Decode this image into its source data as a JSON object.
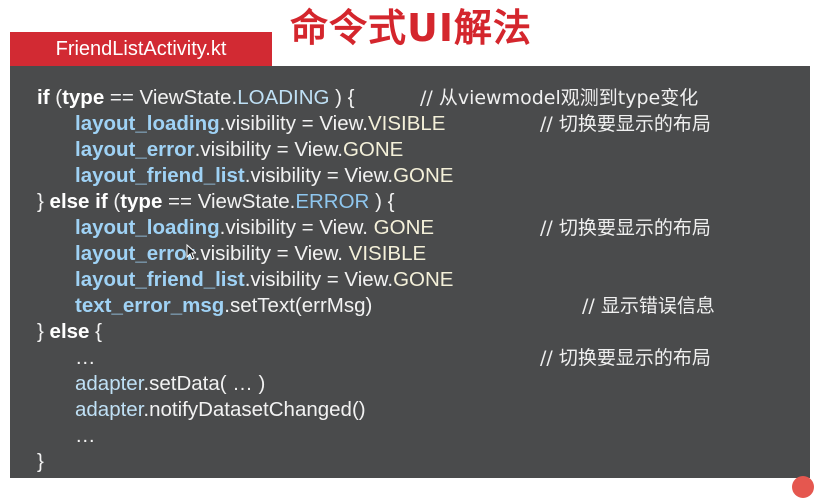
{
  "slide": {
    "title": "命令式UI解法",
    "file_tab": "FriendListActivity.kt"
  },
  "code": {
    "l1": {
      "kw_if": "if",
      "p1": " (",
      "type": "type",
      "p2": " == ViewState.",
      "c": "LOADING",
      "p3": " ) {"
    },
    "l2": {
      "id": "layout_loading",
      "p1": ".visibility = View.",
      "c": "VISIBLE"
    },
    "l3": {
      "id": "layout_error",
      "p1": ".visibility = View.",
      "c": "GONE"
    },
    "l4": {
      "id": "layout_friend_list",
      "p1": ".visibility = View.",
      "c": "GONE"
    },
    "l5": {
      "p0": "} ",
      "kw": "else if",
      "p1": " (",
      "type": "type",
      "p2": " == ViewState.",
      "c": "ERROR",
      "p3": " ) {"
    },
    "l6": {
      "id": "layout_loading",
      "p1": ".visibility = View. ",
      "c": "GONE"
    },
    "l7": {
      "id": "layout_error",
      "p1": ".visibility = View. ",
      "c": "VISIBLE"
    },
    "l8": {
      "id": "layout_friend_list",
      "p1": ".visibility = View.",
      "c": "GONE"
    },
    "l9": {
      "id": "text_error_msg",
      "p1": ".setText(errMsg)"
    },
    "l10": {
      "p0": "} ",
      "kw": "else",
      "p1": " {"
    },
    "l11": {
      "t": "…"
    },
    "l12": {
      "id": "adapter",
      "p1": ".setData( … )"
    },
    "l13": {
      "id": "adapter",
      "p1": ".notifyDatasetChanged()"
    },
    "l14": {
      "t": "…"
    },
    "l15": {
      "t": "}"
    }
  },
  "comments": {
    "c1": "// 从viewmodel观测到type变化",
    "c2": "// 切换要显示的布局",
    "c6": "// 切换要显示的布局",
    "c9": "// 显示错误信息",
    "c11": "// 切换要显示的布局"
  }
}
